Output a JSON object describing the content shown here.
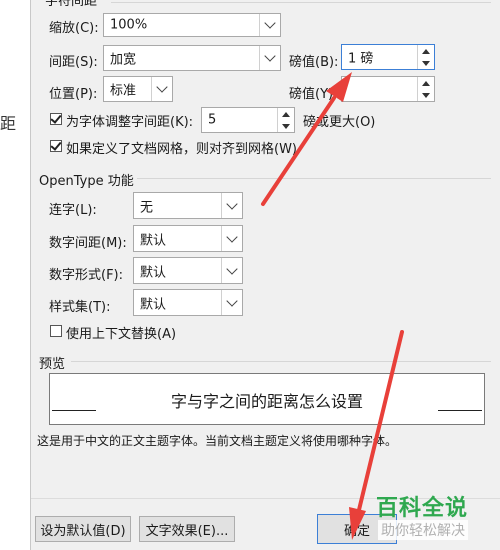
{
  "background_fragment": "距",
  "section_title": "字符间距",
  "scale": {
    "label": "缩放(C):",
    "value": "100%"
  },
  "spacing": {
    "label": "间距(S):",
    "value": "加宽"
  },
  "spacing_by": {
    "label": "磅值(B):",
    "value": "1 磅"
  },
  "position": {
    "label": "位置(P):",
    "value": "标准"
  },
  "position_by": {
    "label": "磅值(Y):",
    "value": ""
  },
  "kerning": {
    "label": "为字体调整字间距(K):",
    "value": "5",
    "suffix": "磅或更大(O)",
    "checked": true
  },
  "grid_snap": {
    "label": "如果定义了文档网格，则对齐到网格(W)",
    "checked": true
  },
  "opentype": {
    "title": "OpenType 功能",
    "ligatures": {
      "label": "连字(L):",
      "value": "无"
    },
    "number_spacing": {
      "label": "数字间距(M):",
      "value": "默认"
    },
    "number_forms": {
      "label": "数字形式(F):",
      "value": "默认"
    },
    "stylistic_sets": {
      "label": "样式集(T):",
      "value": "默认"
    },
    "contextual_alternates": {
      "label": "使用上下文替换(A)",
      "checked": false
    }
  },
  "preview": {
    "title": "预览",
    "sample_text": "字与字之间的距离怎么设置",
    "note": "这是用于中文的正文主题字体。当前文档主题定义将使用哪种字体。"
  },
  "buttons": {
    "set_default": "设为默认值(D)",
    "text_effects": "文字效果(E)...",
    "ok": "确定"
  },
  "watermark": {
    "title": "百科全说",
    "subtitle": "助你轻松解决"
  },
  "colors": {
    "arrow": "#e8403a",
    "focus": "#3c7fd6",
    "dialog_bg": "#f0f0f0"
  }
}
